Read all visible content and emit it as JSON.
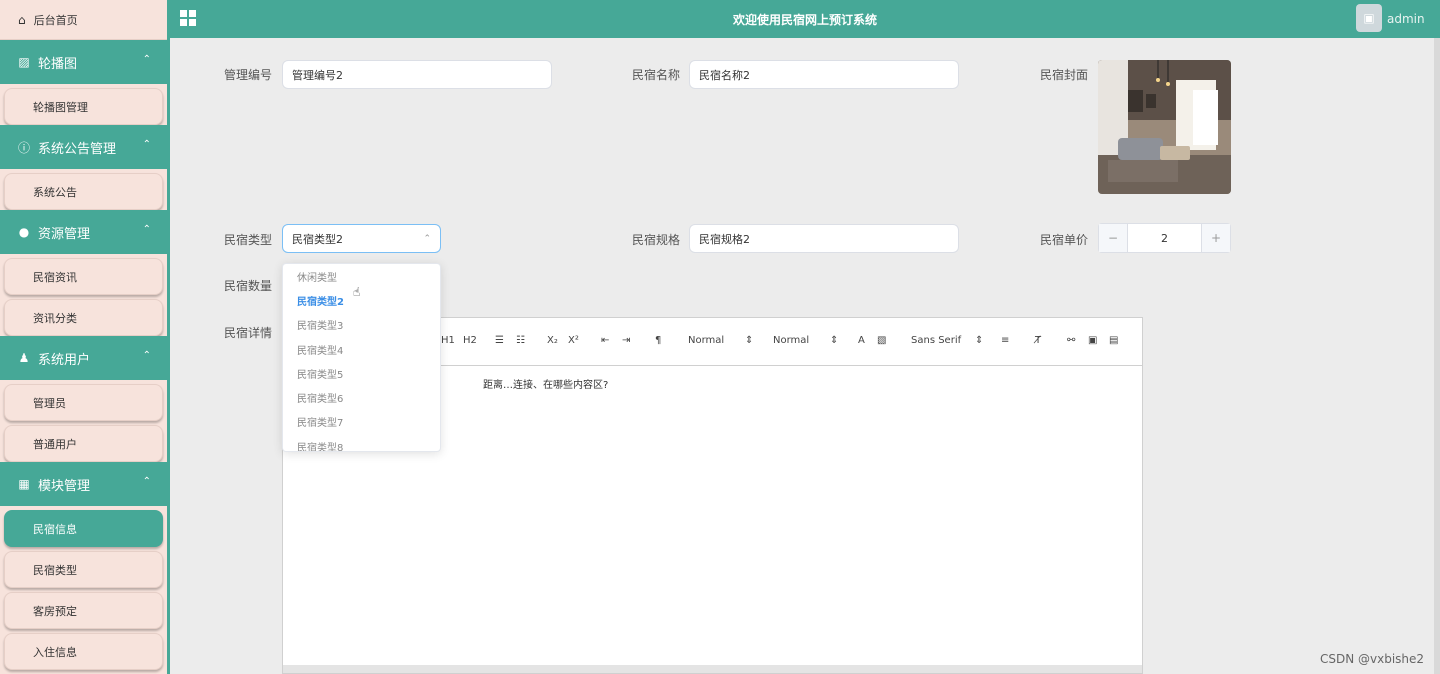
{
  "header": {
    "title": "欢迎使用民宿网上预订系统",
    "user": "admin"
  },
  "sidebar": {
    "home": "后台首页",
    "groups": [
      {
        "title": "轮播图",
        "items": [
          "轮播图管理"
        ]
      },
      {
        "title": "系统公告管理",
        "items": [
          "系统公告"
        ]
      },
      {
        "title": "资源管理",
        "items": [
          "民宿资讯",
          "资讯分类"
        ]
      },
      {
        "title": "系统用户",
        "items": [
          "管理员",
          "普通用户"
        ]
      },
      {
        "title": "模块管理",
        "items": [
          "民宿信息",
          "民宿类型",
          "客房预定",
          "入住信息"
        ]
      }
    ]
  },
  "form": {
    "code_label": "管理编号",
    "code_value": "管理编号2",
    "name_label": "民宿名称",
    "name_value": "民宿名称2",
    "cover_label": "民宿封面",
    "type_label": "民宿类型",
    "type_value": "民宿类型2",
    "spec_label": "民宿规格",
    "spec_value": "民宿规格2",
    "price_label": "民宿单价",
    "price_value": "2",
    "count_label": "民宿数量",
    "detail_label": "民宿详情"
  },
  "dropdown": {
    "options": [
      "休闲类型",
      "民宿类型2",
      "民宿类型3",
      "民宿类型4",
      "民宿类型5",
      "民宿类型6",
      "民宿类型7",
      "民宿类型8"
    ]
  },
  "editor": {
    "toolbar": {
      "header1": "H1",
      "header2": "H2",
      "size": "Normal",
      "header": "Normal",
      "font": "Sans Serif"
    },
    "content": "距离…连接、在哪些内容区?"
  },
  "watermark": "CSDN @vxbishe2",
  "colors": {
    "accent": "#46a897",
    "sidebar_bg": "#f7e3dc",
    "selected": "#3a8ee6"
  }
}
